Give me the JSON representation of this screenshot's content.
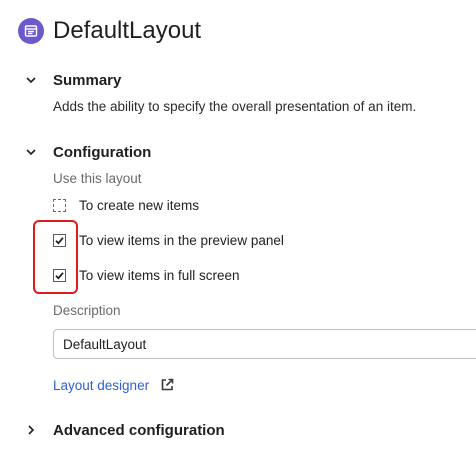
{
  "header": {
    "title": "DefaultLayout",
    "icon": "layout-icon",
    "icon_color": "#6a5acd"
  },
  "summary": {
    "title": "Summary",
    "expanded": true,
    "text": "Adds the ability to specify the overall presentation of an item."
  },
  "configuration": {
    "title": "Configuration",
    "expanded": true,
    "use_label": "Use this layout",
    "options": [
      {
        "label": "To create new items",
        "checked": false
      },
      {
        "label": "To view items in the preview panel",
        "checked": true
      },
      {
        "label": "To view items in full screen",
        "checked": true
      }
    ],
    "description_label": "Description",
    "description_value": "DefaultLayout",
    "link_label": "Layout designer",
    "link_icon": "external-link-icon"
  },
  "advanced": {
    "title": "Advanced configuration",
    "expanded": false
  },
  "colors": {
    "highlight": "#e01b1b",
    "link": "#2f5fd0"
  }
}
